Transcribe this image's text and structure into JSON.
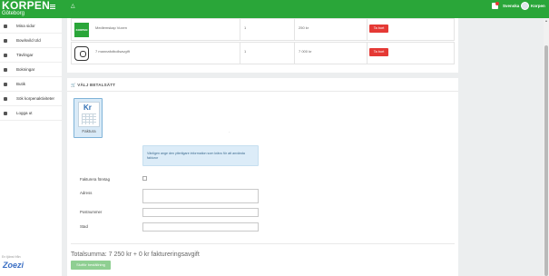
{
  "header": {
    "logo": "KORPEN",
    "logo_sub": "Göteborg",
    "language": "Svenska",
    "user": "Korpen",
    "colors": {
      "brand": "#2aa639",
      "badge": "#e53935"
    },
    "icons": [
      "menu-icon",
      "bell-icon",
      "cart-icon",
      "avatar"
    ]
  },
  "sidebar": {
    "items": [
      {
        "label": "Mina sidor",
        "icon": "person-icon"
      },
      {
        "label": "Bowlsvild Uld",
        "icon": "group-icon"
      },
      {
        "label": "Tävlingar",
        "icon": "trophy-icon"
      },
      {
        "label": "Bokningar",
        "icon": "pin-icon"
      },
      {
        "label": "Butik",
        "icon": "cart-icon"
      },
      {
        "label": "Sök korpenaktiviteter",
        "icon": "search-icon"
      },
      {
        "label": "Logga ut",
        "icon": "power-icon"
      }
    ],
    "footer": "En tjänst från",
    "brand": "Zoezi"
  },
  "cart": {
    "rows": [
      {
        "name": "Medlemskap Vuxen",
        "qty": "1",
        "price": "250 kr",
        "remove_label": "Ta bort",
        "thumb": "KORPEN"
      },
      {
        "name": "7 mannafotbollsavgift",
        "qty": "1",
        "price": "7 000 kr",
        "remove_label": "Ta bort",
        "thumb": ""
      }
    ]
  },
  "payment": {
    "header": "VÄLJ BETALSÄTT",
    "option_label": "Faktura",
    "option_icon_text": "Kr",
    "dot": ".",
    "info": "Vänligen ange den ytterligare information som krävs för att använda fakturor"
  },
  "form": {
    "company_label": "Fakturera företag",
    "address_label": "Adress",
    "postal_label": "Postnummer",
    "city_label": "Stad"
  },
  "summary": {
    "total": "Totalsumma: 7 250 kr + 0 kr faktureringsavgift",
    "submit_label": "Slutför beställning"
  }
}
